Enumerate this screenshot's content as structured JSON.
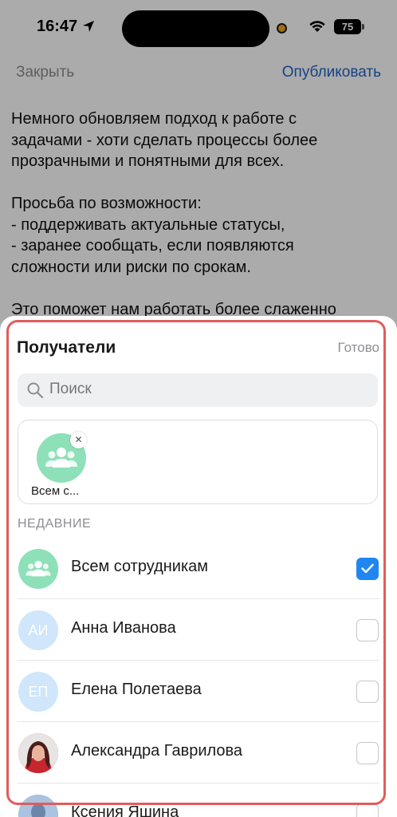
{
  "status_bar": {
    "time": "16:47",
    "battery": "75"
  },
  "nav": {
    "close_label": "Закрыть",
    "publish_label": "Опубликовать"
  },
  "post": {
    "paragraph1": [
      "Немного обновляем подход к работе с",
      "задачами - хоти сделать процессы более",
      "прозрачными и понятными для всех."
    ],
    "paragraph2": [
      "Просьба по возможности:",
      "- поддерживать актуальные статусы,",
      "- заранее сообщать, если появляются",
      "сложности или риски по срокам."
    ],
    "paragraph3": [
      "Это поможет нам работать более слаженно"
    ]
  },
  "sheet": {
    "title": "Получатели",
    "done_label": "Готово",
    "search_placeholder": "Поиск",
    "selected_chip_label": "Всем с...",
    "section_recent": "НЕДАВНИЕ",
    "recipients": [
      {
        "name": "Всем сотрудникам",
        "avatar_type": "group",
        "checked": true
      },
      {
        "name": "Анна Иванова",
        "avatar_type": "initials",
        "initials": "АИ",
        "checked": false
      },
      {
        "name": "Елена Полетаева",
        "avatar_type": "initials",
        "initials": "ЕП",
        "checked": false
      },
      {
        "name": "Александра Гаврилова",
        "avatar_type": "photo",
        "checked": false
      },
      {
        "name": "Ксения Яшина",
        "avatar_type": "photo",
        "checked": false
      }
    ]
  },
  "colors": {
    "accent": "#1e63c9",
    "checkbox_checked": "#1f86f2",
    "group_avatar": "#8ee0b9",
    "highlight": "#e25c5c"
  }
}
